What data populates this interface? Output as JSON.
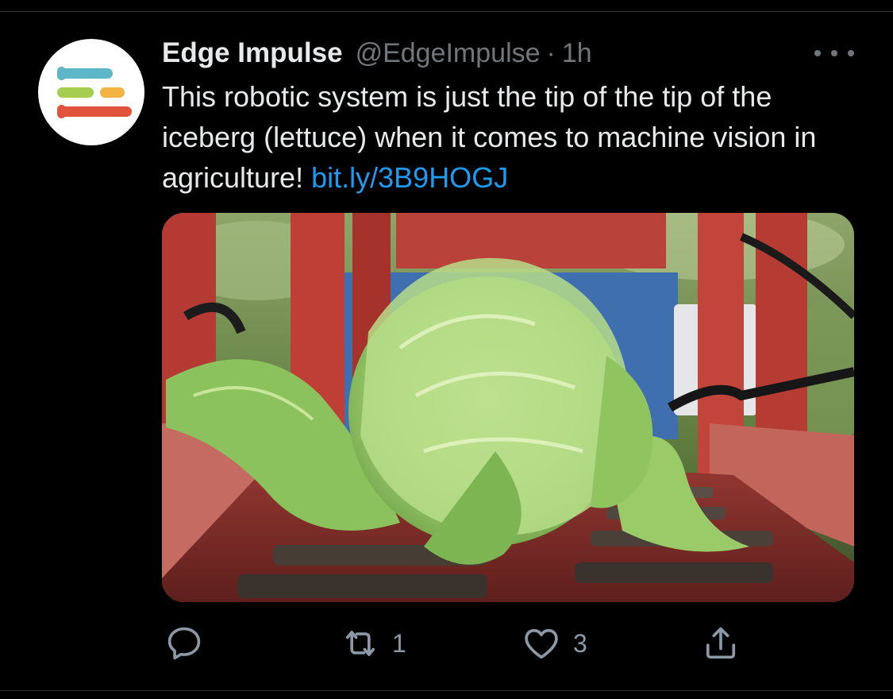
{
  "tweet": {
    "author": {
      "display_name": "Edge Impulse",
      "handle": "@EdgeImpulse",
      "avatar_icon": "edge-impulse-logo-icon",
      "logo_colors": [
        "#5db7c9",
        "#a6cd4f",
        "#f2b340",
        "#e0533d"
      ]
    },
    "separator": "·",
    "timestamp": "1h",
    "text": "This robotic system is just the tip of the tip of the iceberg (lettuce) when it comes to machine vision in agriculture!",
    "link_text": "bit.ly/3B9HOGJ",
    "media": {
      "icon": "lettuce-photo",
      "alt": "Iceberg lettuce on a red robotic conveyor in a field"
    }
  },
  "actions": {
    "reply": {
      "icon": "reply-icon",
      "count": ""
    },
    "retweet": {
      "icon": "retweet-icon",
      "count": "1"
    },
    "like": {
      "icon": "heart-icon",
      "count": "3"
    },
    "share": {
      "icon": "share-icon",
      "count": ""
    }
  },
  "colors": {
    "background": "#000000",
    "text": "#e7e9ea",
    "secondary": "#71767b",
    "link": "#1d9bf0",
    "divider": "#2f3336"
  }
}
